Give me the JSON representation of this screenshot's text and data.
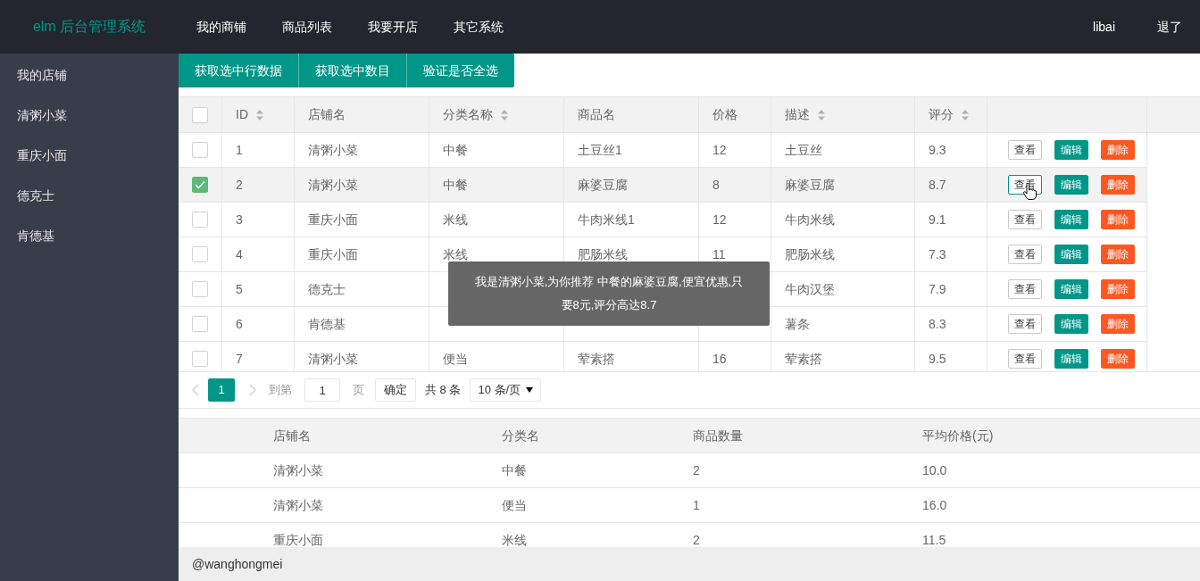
{
  "header": {
    "logo": "elm 后台管理系统",
    "nav": [
      {
        "label": "我的商铺"
      },
      {
        "label": "商品列表"
      },
      {
        "label": "我要开店"
      },
      {
        "label": "其它系统"
      }
    ],
    "user": "libai",
    "logout": "退了"
  },
  "sidebar": {
    "items": [
      {
        "label": "我的店铺"
      },
      {
        "label": "清粥小菜"
      },
      {
        "label": "重庆小面"
      },
      {
        "label": "德克士"
      },
      {
        "label": "肯德基"
      }
    ]
  },
  "toolbar": [
    "获取选中行数据",
    "获取选中数目",
    "验证是否全选"
  ],
  "table": {
    "all_checked": false,
    "columns": [
      {
        "label": "ID",
        "sortable": true
      },
      {
        "label": "店铺名",
        "sortable": false
      },
      {
        "label": "分类名称",
        "sortable": true
      },
      {
        "label": "商品名",
        "sortable": false
      },
      {
        "label": "价格",
        "sortable": false
      },
      {
        "label": "描述",
        "sortable": true
      },
      {
        "label": "评分",
        "sortable": true
      }
    ],
    "rows": [
      {
        "cells": [
          "1",
          "清粥小菜",
          "中餐",
          "土豆丝1",
          "12",
          "土豆丝",
          "9.3"
        ],
        "selected": false,
        "actions": [
          {
            "kind": "view",
            "label": "查看",
            "hovered": false
          },
          {
            "kind": "edit",
            "label": "编辑",
            "hovered": false
          },
          {
            "kind": "delete",
            "label": "删除",
            "hovered": false
          }
        ]
      },
      {
        "cells": [
          "2",
          "清粥小菜",
          "中餐",
          "麻婆豆腐",
          "8",
          "麻婆豆腐",
          "8.7"
        ],
        "selected": true,
        "actions": [
          {
            "kind": "view",
            "label": "查看",
            "hovered": true
          },
          {
            "kind": "edit",
            "label": "编辑",
            "hovered": false
          },
          {
            "kind": "delete",
            "label": "删除",
            "hovered": false
          }
        ]
      },
      {
        "cells": [
          "3",
          "重庆小面",
          "米线",
          "牛肉米线1",
          "12",
          "牛肉米线",
          "9.1"
        ],
        "selected": false,
        "actions": [
          {
            "kind": "view",
            "label": "查看",
            "hovered": false
          },
          {
            "kind": "edit",
            "label": "编辑",
            "hovered": false
          },
          {
            "kind": "delete",
            "label": "删除",
            "hovered": false
          }
        ]
      },
      {
        "cells": [
          "4",
          "重庆小面",
          "米线",
          "肥肠米线",
          "11",
          "肥肠米线",
          "7.3"
        ],
        "selected": false,
        "actions": [
          {
            "kind": "view",
            "label": "查看",
            "hovered": false
          },
          {
            "kind": "edit",
            "label": "编辑",
            "hovered": false
          },
          {
            "kind": "delete",
            "label": "删除",
            "hovered": false
          }
        ]
      },
      {
        "cells": [
          "5",
          "德克士",
          null,
          null,
          null,
          "牛肉汉堡",
          "7.9"
        ],
        "selected": false,
        "actions": [
          {
            "kind": "view",
            "label": "查看",
            "hovered": false
          },
          {
            "kind": "edit",
            "label": "编辑",
            "hovered": false
          },
          {
            "kind": "delete",
            "label": "删除",
            "hovered": false
          }
        ]
      },
      {
        "cells": [
          "6",
          "肯德基",
          null,
          null,
          null,
          "薯条",
          "8.3"
        ],
        "selected": false,
        "actions": [
          {
            "kind": "view",
            "label": "查看",
            "hovered": false
          },
          {
            "kind": "edit",
            "label": "编辑",
            "hovered": false
          },
          {
            "kind": "delete",
            "label": "删除",
            "hovered": false
          }
        ]
      },
      {
        "cells": [
          "7",
          "清粥小菜",
          "便当",
          "荤素搭",
          "16",
          "荤素搭",
          "9.5"
        ],
        "selected": false,
        "actions": [
          {
            "kind": "view",
            "label": "查看",
            "hovered": false
          },
          {
            "kind": "edit",
            "label": "编辑",
            "hovered": false
          },
          {
            "kind": "delete",
            "label": "删除",
            "hovered": false
          }
        ]
      }
    ]
  },
  "tooltip": "我是清粥小菜,为你推荐 中餐的麻婆豆腐,便宜优惠,只要8元,评分高达8.7",
  "pagination": {
    "pages": [
      {
        "label": "1",
        "selected": true
      }
    ],
    "goto_label": "到第",
    "page_input": "1",
    "page_unit": "页",
    "confirm": "确定",
    "total": "共 8 条",
    "page_size": "10 条/页"
  },
  "summary": {
    "columns": [
      "店铺名",
      "分类名",
      "商品数量",
      "平均价格(元)"
    ],
    "rows": [
      [
        "清粥小菜",
        "中餐",
        "2",
        "10.0"
      ],
      [
        "清粥小菜",
        "便当",
        "1",
        "16.0"
      ],
      [
        "重庆小面",
        "米线",
        "2",
        "11.5"
      ]
    ]
  },
  "footer": "@wanghongmei"
}
